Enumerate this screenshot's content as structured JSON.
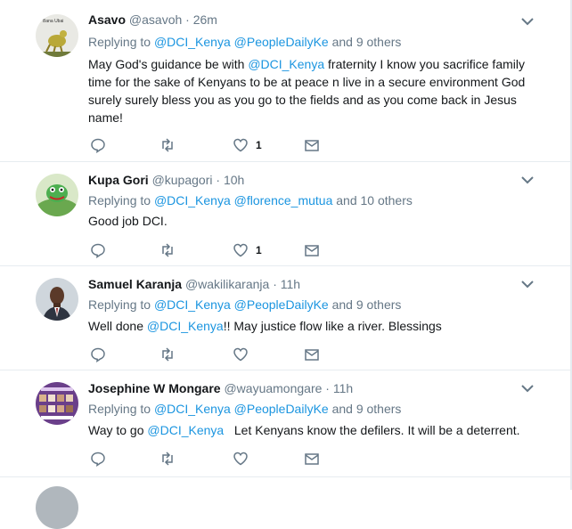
{
  "tweets": [
    {
      "name": "Asavo",
      "handle": "@asavoh",
      "time": "26m",
      "replying_prefix": "Replying to",
      "mentions": [
        "@DCI_Kenya",
        "@PeopleDailyKe"
      ],
      "others": "and 9 others",
      "text_parts": [
        "May God's guidance be with ",
        "@DCI_Kenya",
        " fraternity I know you sacrifice family time for the sake of Kenyans to be at peace n live in a secure environment  God surely surely bless you as you go to the fields and as you come back in Jesus name!"
      ],
      "like_count": "1",
      "avatar_caption": "Bana Ubai"
    },
    {
      "name": "Kupa Gori",
      "handle": "@kupagori",
      "time": "10h",
      "replying_prefix": "Replying to",
      "mentions": [
        "@DCI_Kenya",
        "@florence_mutua"
      ],
      "others": "and 10 others",
      "text_parts": [
        "Good job DCI."
      ],
      "like_count": "1"
    },
    {
      "name": "Samuel Karanja",
      "handle": "@wakilikaranja",
      "time": "11h",
      "replying_prefix": "Replying to",
      "mentions": [
        "@DCI_Kenya",
        "@PeopleDailyKe"
      ],
      "others": "and 9 others",
      "text_parts": [
        "Well done ",
        "@DCI_Kenya",
        "!! May justice flow like a river. Blessings"
      ],
      "like_count": ""
    },
    {
      "name": "Josephine W Mongare",
      "handle": "@wayuamongare",
      "time": "11h",
      "replying_prefix": "Replying to",
      "mentions": [
        "@DCI_Kenya",
        "@PeopleDailyKe"
      ],
      "others": "and 9 others",
      "text_parts": [
        "Way to go ",
        "@DCI_Kenya",
        "   Let Kenyans know the defilers. It will be a deterrent."
      ],
      "like_count": ""
    }
  ],
  "separator_dot": "·",
  "icons": {
    "reply": "reply-icon",
    "retweet": "retweet-icon",
    "like": "heart-icon",
    "dm": "envelope-icon",
    "more": "chevron-down-icon"
  },
  "colors": {
    "mention": "#1b95e0",
    "muted": "#657786",
    "border": "#e6ecf0"
  }
}
